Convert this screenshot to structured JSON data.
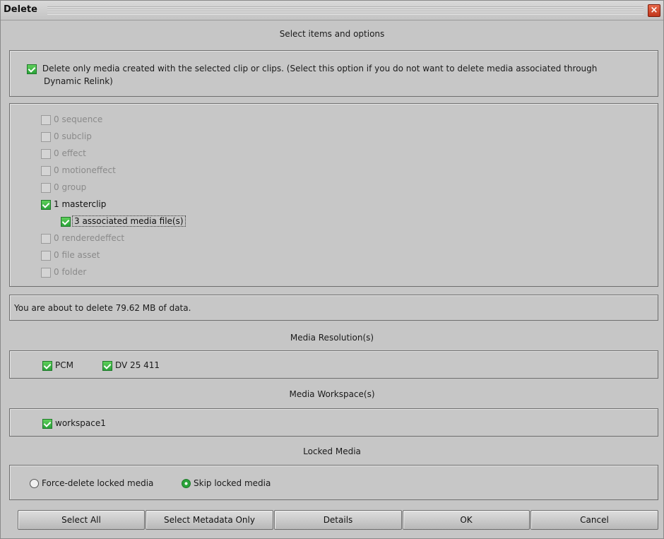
{
  "window": {
    "title": "Delete",
    "close_label": "×"
  },
  "sections": {
    "items_options": "Select items and options",
    "media_resolutions": "Media Resolution(s)",
    "media_workspaces": "Media Workspace(s)",
    "locked_media": "Locked Media"
  },
  "delete_only_option": {
    "checked": true,
    "label_line1": "Delete only media created with the selected clip or clips. (Select this option if you do not want to delete media associated through",
    "label_line2": "Dynamic Relink)"
  },
  "items": [
    {
      "label": "0 sequence",
      "checked": false,
      "enabled": false
    },
    {
      "label": "0 subclip",
      "checked": false,
      "enabled": false
    },
    {
      "label": "0 effect",
      "checked": false,
      "enabled": false
    },
    {
      "label": "0 motioneffect",
      "checked": false,
      "enabled": false
    },
    {
      "label": "0 group",
      "checked": false,
      "enabled": false
    },
    {
      "label": "1 masterclip",
      "checked": true,
      "enabled": true
    },
    {
      "label": "3 associated media file(s)",
      "checked": true,
      "enabled": true
    },
    {
      "label": "0 renderedeffect",
      "checked": false,
      "enabled": false
    },
    {
      "label": "0 file asset",
      "checked": false,
      "enabled": false
    },
    {
      "label": "0 folder",
      "checked": false,
      "enabled": false
    }
  ],
  "status": {
    "message": "You are about to delete 79.62 MB of data."
  },
  "resolutions": [
    {
      "label": "PCM",
      "checked": true
    },
    {
      "label": "DV 25 411",
      "checked": true
    }
  ],
  "workspaces": [
    {
      "label": "workspace1",
      "checked": true
    }
  ],
  "locked_options": [
    {
      "label": "Force-delete locked media",
      "selected": false
    },
    {
      "label": "Skip locked media",
      "selected": true
    }
  ],
  "buttons": {
    "select_all": "Select All",
    "select_metadata_only": "Select Metadata Only",
    "details": "Details",
    "ok": "OK",
    "cancel": "Cancel"
  },
  "colors": {
    "check_green": "#2aa33a",
    "window_bg": "#c6c6c6",
    "close_red": "#c0351b"
  }
}
